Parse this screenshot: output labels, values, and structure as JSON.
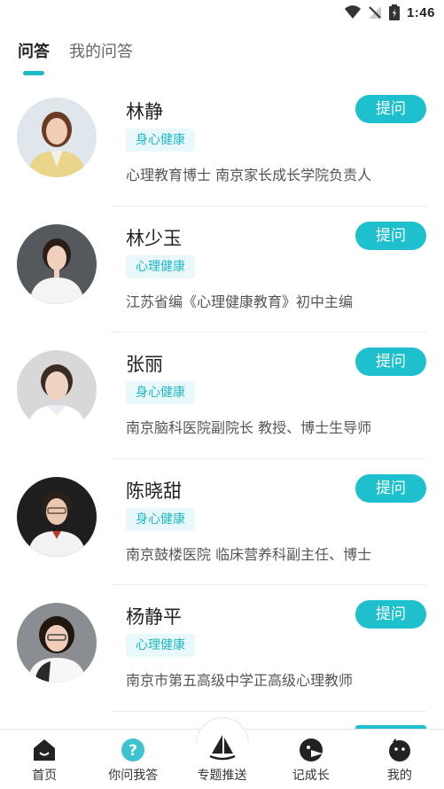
{
  "status_bar": {
    "time": "1:46"
  },
  "tabs": [
    {
      "label": "问答",
      "active": true
    },
    {
      "label": "我的问答",
      "active": false
    }
  ],
  "experts": [
    {
      "name": "林静",
      "tag": "身心健康",
      "desc": "心理教育博士 南京家长成长学院负责人",
      "button": "提问"
    },
    {
      "name": "林少玉",
      "tag": "心理健康",
      "desc": "江苏省编《心理健康教育》初中主编",
      "button": "提问"
    },
    {
      "name": "张丽",
      "tag": "身心健康",
      "desc": "南京脑科医院副院长 教授、博士生导师",
      "button": "提问"
    },
    {
      "name": "陈晓甜",
      "tag": "身心健康",
      "desc": "南京鼓楼医院 临床营养科副主任、博士",
      "button": "提问"
    },
    {
      "name": "杨静平",
      "tag": "心理健康",
      "desc": "南京市第五高级中学正高级心理教师",
      "button": "提问"
    }
  ],
  "bottom_nav": [
    {
      "label": "首页",
      "icon": "home-icon"
    },
    {
      "label": "你问我答",
      "icon": "question-icon"
    },
    {
      "label": "专题推送",
      "icon": "sailboat-icon"
    },
    {
      "label": "记成长",
      "icon": "growth-icon"
    },
    {
      "label": "我的",
      "icon": "profile-icon"
    }
  ],
  "colors": {
    "accent": "#1fc0cd",
    "tag_bg": "#e9f8fa",
    "text": "#222222"
  }
}
